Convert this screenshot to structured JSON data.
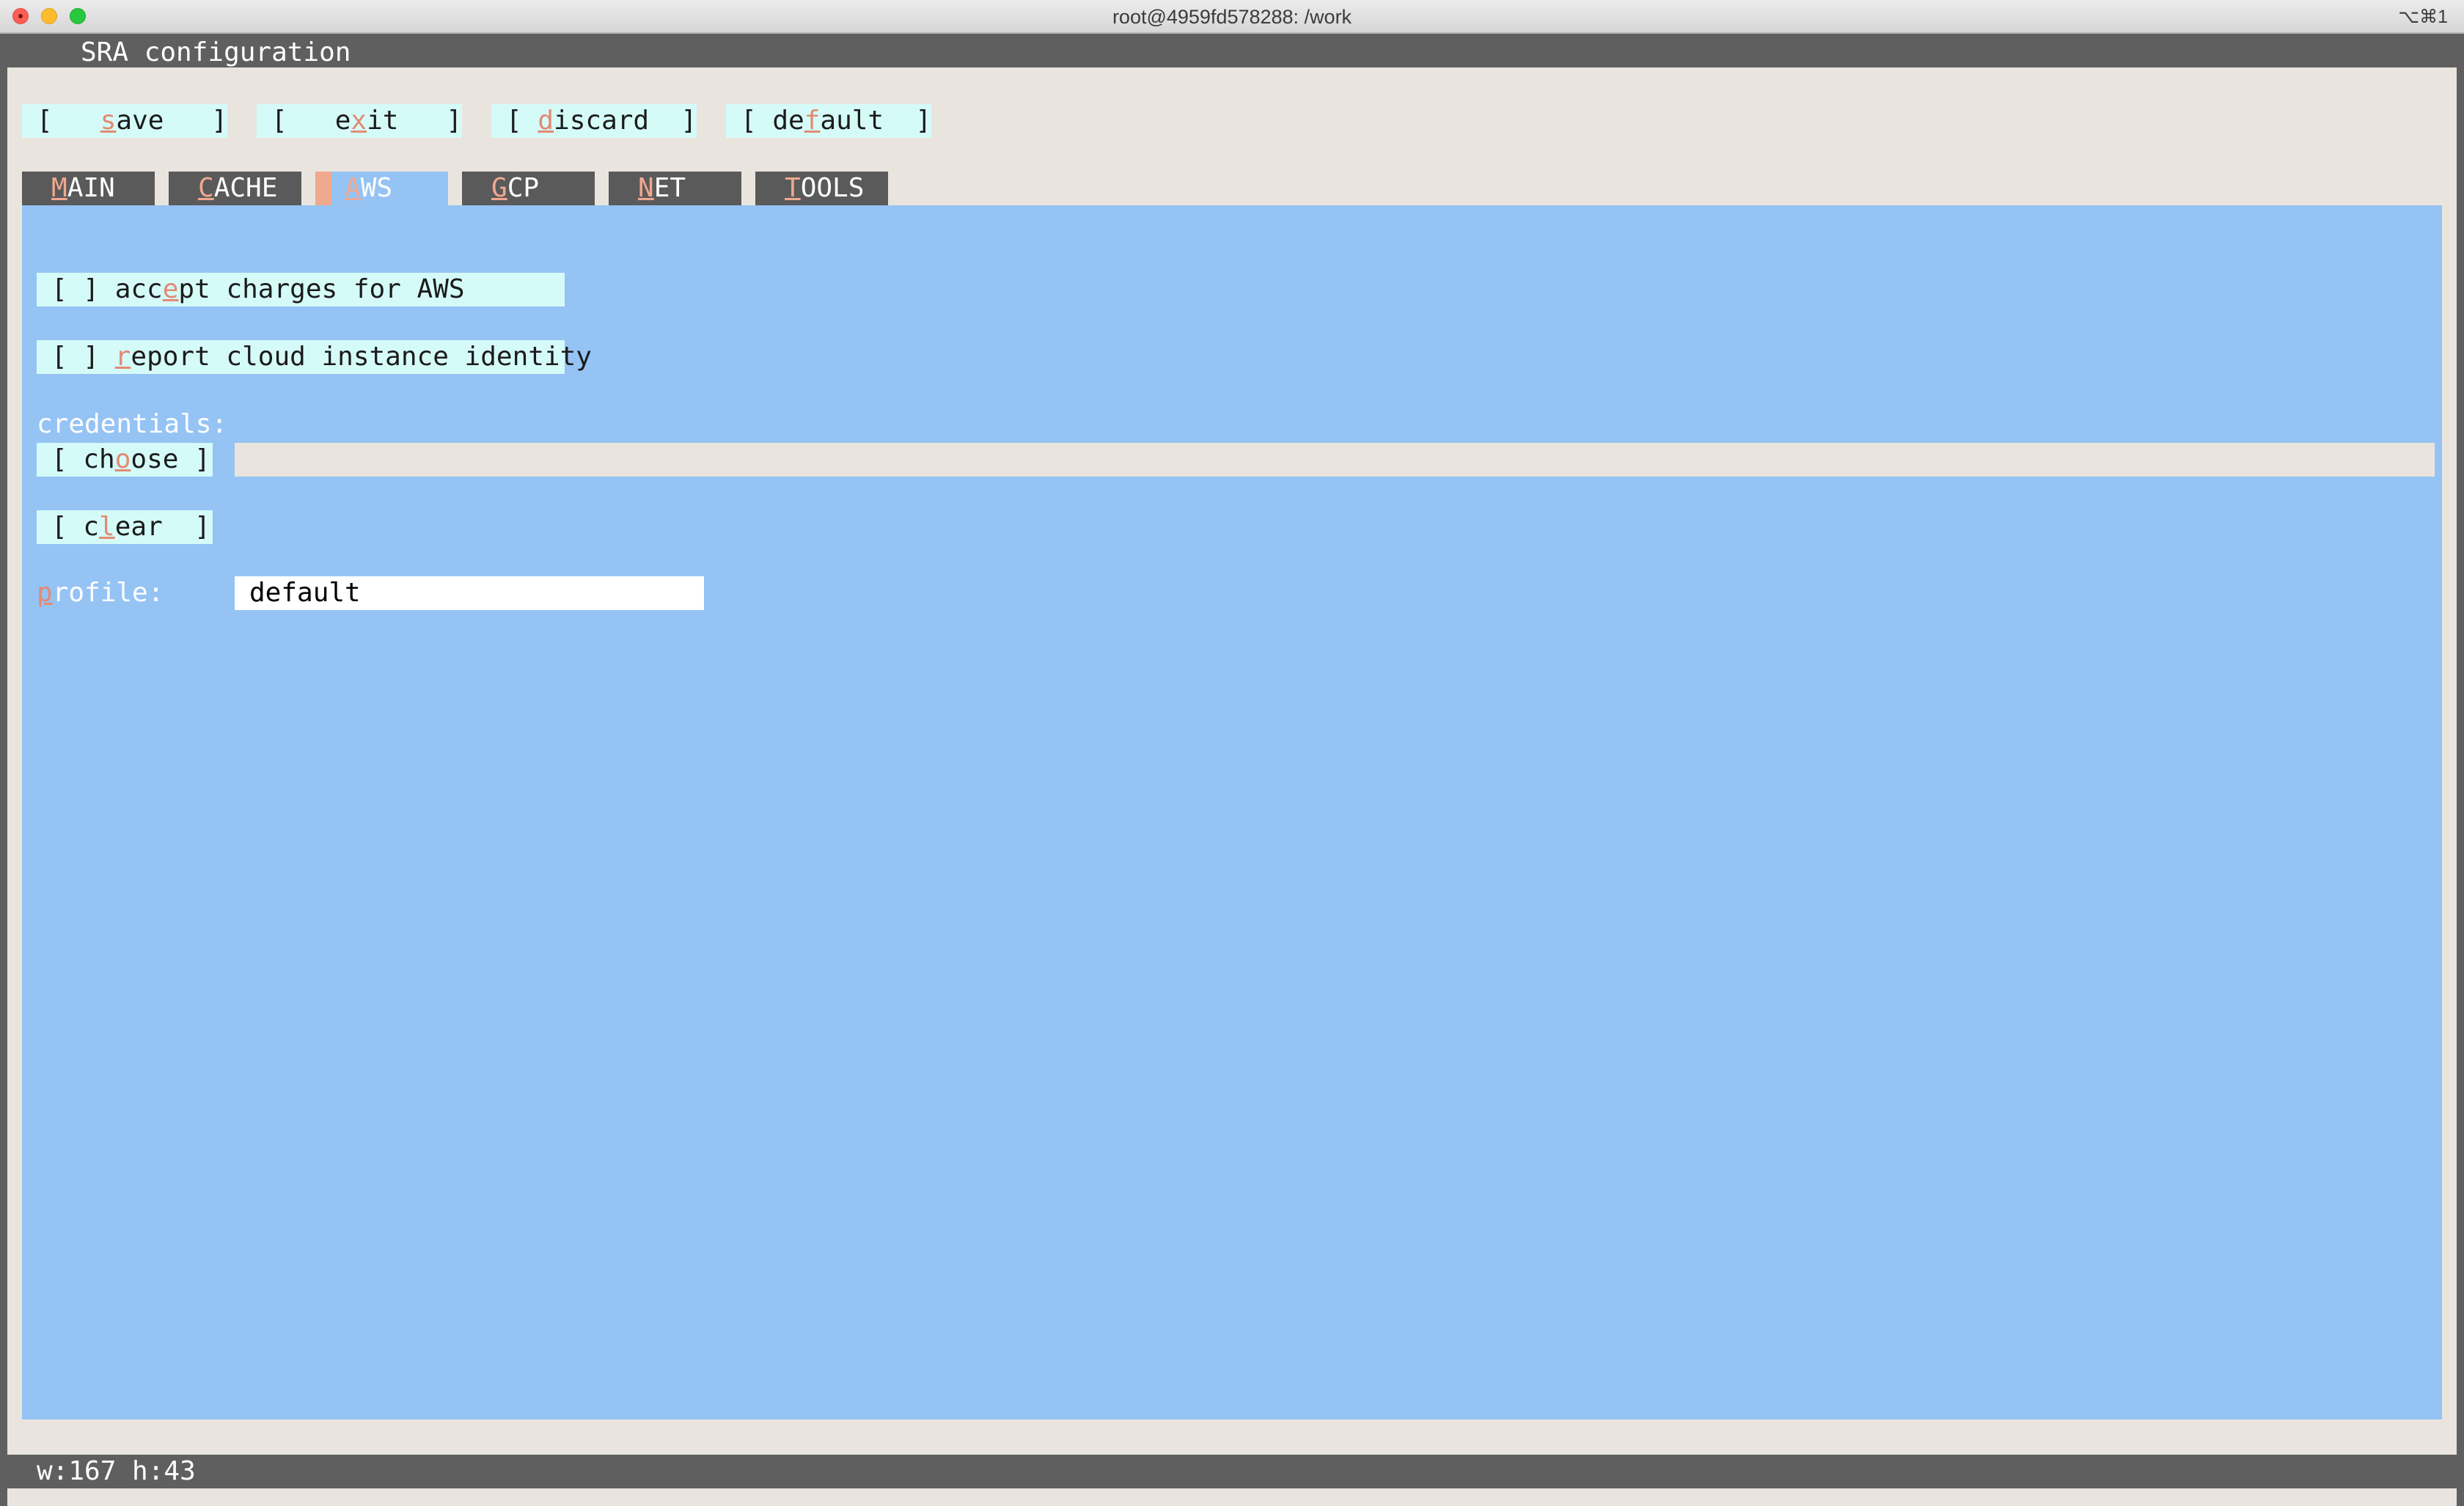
{
  "window": {
    "title": "root@4959fd578288: /work",
    "shortcut": "⌥⌘1"
  },
  "app": {
    "title": "SRA configuration"
  },
  "toolbar": {
    "buttons": [
      {
        "open": "[   ",
        "hotkey": "s",
        "rest": "ave   ]"
      },
      {
        "open": "[   e",
        "hotkey": "x",
        "rest": "it   ]"
      },
      {
        "open": "[ ",
        "hotkey": "d",
        "rest": "iscard  ]"
      },
      {
        "open": "[ de",
        "hotkey": "f",
        "rest": "ault  ]"
      }
    ]
  },
  "tabs": [
    {
      "hotkey": "M",
      "rest": "AIN",
      "active": false
    },
    {
      "hotkey": "C",
      "rest": "ACHE",
      "active": false
    },
    {
      "hotkey": "A",
      "rest": "WS",
      "active": true
    },
    {
      "hotkey": "G",
      "rest": "CP",
      "active": false
    },
    {
      "hotkey": "N",
      "rest": "ET",
      "active": false
    },
    {
      "hotkey": "T",
      "rest": "OOLS",
      "active": false
    }
  ],
  "aws": {
    "accept_charges": {
      "box": "[ ] ",
      "pre": "acc",
      "hotkey": "e",
      "rest": "pt charges for AWS",
      "checked": false
    },
    "report_identity": {
      "box": "[ ] ",
      "pre": "",
      "hotkey": "r",
      "rest": "eport cloud instance identity",
      "checked": false
    },
    "credentials_label": "credentials:",
    "choose_button": {
      "open": "[ ch",
      "hotkey": "o",
      "rest": "ose ]"
    },
    "credentials_value": "",
    "clear_button": {
      "open": "[ c",
      "hotkey": "l",
      "rest": "ear  ]"
    },
    "profile_label": {
      "hotkey": "p",
      "rest": "rofile:"
    },
    "profile_value": "default"
  },
  "status": {
    "text": "w:167 h:43"
  },
  "colors": {
    "panel": "#95c3f4",
    "button": "#d5fbf8",
    "hotkey": "#e38a73",
    "terminal_bg": "#e9e5de",
    "bar": "#5f5f5f"
  }
}
